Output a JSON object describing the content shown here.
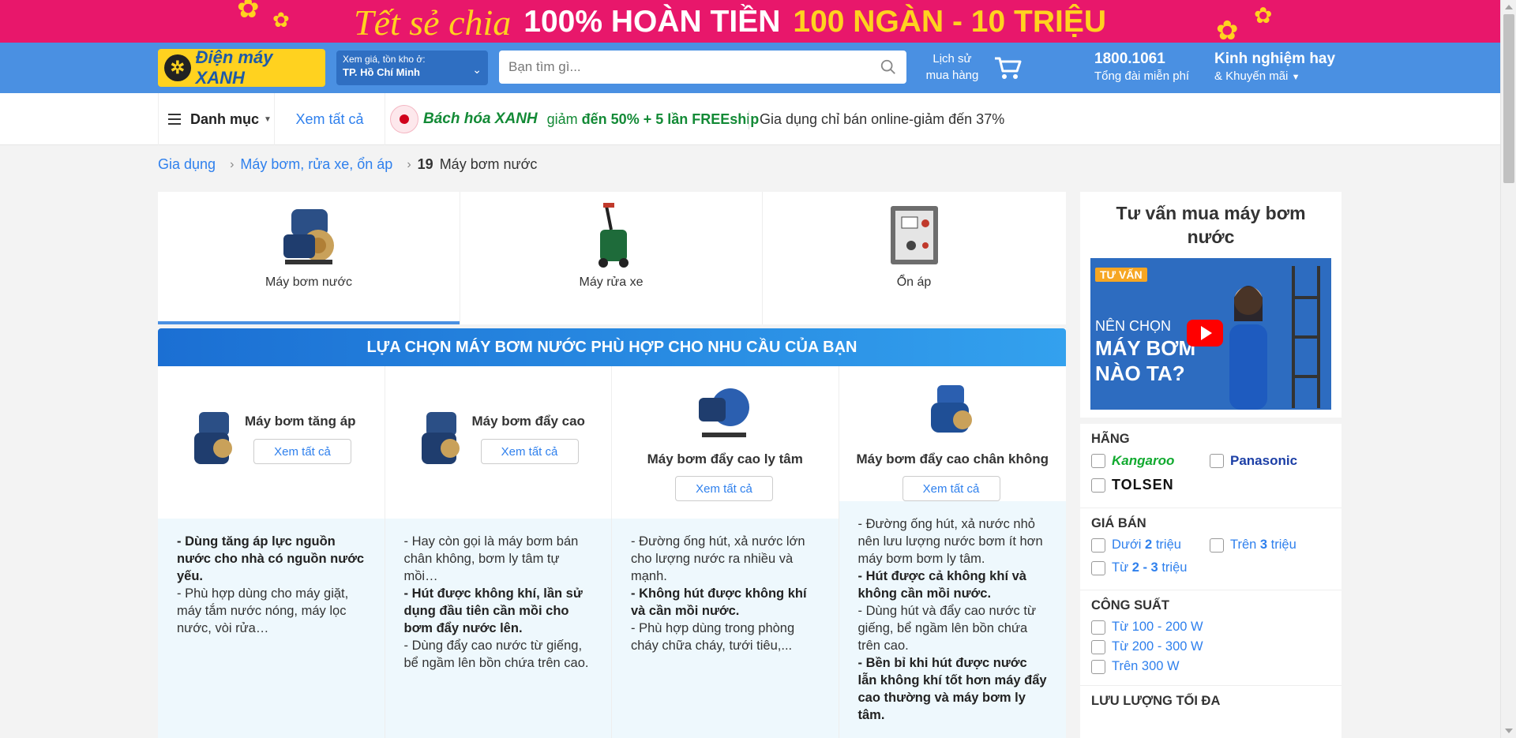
{
  "banner": {
    "script_text": "Tết sẻ chia",
    "highlight_text": "100% HOÀN TIỀN",
    "amount_text": "100 NGÀN - 10 TRIỆU"
  },
  "header": {
    "logo_text": "Điện máy XANH",
    "location_label": "Xem giá, tồn kho ở:",
    "location_value": "TP. Hồ Chí Minh",
    "search_placeholder": "Bạn tìm gì...",
    "orders_line1": "Lịch sử",
    "orders_line2": "mua hàng",
    "hotline_number": "1800.1061",
    "hotline_label": "Tổng đài miễn phí",
    "experience_title": "Kinh nghiệm hay",
    "experience_sub": "& Khuyến mãi"
  },
  "nav": {
    "menu_label": "Danh mục",
    "see_all": "Xem tất cả",
    "bhx_brand": "Bách hóa XANH",
    "bhx_promo_prefix": "giảm",
    "bhx_promo_bold": "đến 50% + 5 lần FREEship",
    "giadung_promo": "Gia dụng chỉ bán online-giảm đến 37%"
  },
  "breadcrumb": {
    "level1": "Gia dụng",
    "level2": "Máy bơm, rửa xe, ổn áp",
    "count": "19",
    "current": "Máy bơm nước"
  },
  "categories": [
    {
      "label": "Máy bơm nước",
      "active": true
    },
    {
      "label": "Máy rửa xe",
      "active": false
    },
    {
      "label": "Ổn áp",
      "active": false
    }
  ],
  "selector": {
    "title": "LỰA CHỌN MÁY BƠM NƯỚC PHÙ HỢP CHO NHU CẦU CỦA BẠN",
    "button_label": "Xem tất cả",
    "columns": [
      {
        "title": "Máy bơm tăng áp",
        "desc": [
          {
            "bold": true,
            "text": "- Dùng tăng áp lực nguồn nước cho nhà có nguồn nước yếu."
          },
          {
            "bold": false,
            "text": "- Phù hợp dùng cho máy giặt, máy tắm nước nóng, máy lọc nước, vòi rửa…"
          }
        ]
      },
      {
        "title": "Máy bơm đẩy cao",
        "desc": [
          {
            "bold": false,
            "text": "- Hay còn gọi là máy bơm bán chân không, bơm ly tâm tự mồi…"
          },
          {
            "bold": true,
            "text": "- Hút được không khí, lần sử dụng đầu tiên cần mồi cho bơm đẩy nước lên."
          },
          {
            "bold": false,
            "text": "- Dùng đẩy cao nước từ giếng, bể ngầm lên bồn chứa trên cao."
          }
        ]
      },
      {
        "title": "Máy bơm đẩy cao ly tâm",
        "desc": [
          {
            "bold": false,
            "text": "- Đường ống hút, xả nước lớn cho lượng nước ra nhiều và mạnh."
          },
          {
            "bold": true,
            "text": "- Không hút được không khí và cần mồi nước."
          },
          {
            "bold": false,
            "text": "- Phù hợp dùng trong phòng cháy chữa cháy, tưới tiêu,..."
          }
        ]
      },
      {
        "title": "Máy bơm đẩy cao chân không",
        "desc": [
          {
            "bold": false,
            "text": "- Đường ống hút, xả nước nhỏ nên lưu lượng nước bơm ít hơn máy bơm bơm ly tâm."
          },
          {
            "bold": true,
            "text": "- Hút được cả không khí và không cần mồi nước."
          },
          {
            "bold": false,
            "text": "- Dùng hút và đẩy cao nước từ giếng, bể ngầm lên bồn chứa trên cao."
          },
          {
            "bold": true,
            "text": "- Bền bỉ khi hút được nước lẫn không khí tốt hơn máy đẩy cao thường và máy bơm ly tâm."
          }
        ]
      }
    ]
  },
  "advice": {
    "title": "Tư vấn mua máy bơm nước",
    "video_tag": "TƯ VẤN",
    "video_line1": "NÊN CHỌN",
    "video_line2": "MÁY BƠM",
    "video_line3": "NÀO TA?"
  },
  "filters": {
    "brand_title": "HÃNG",
    "brands": [
      "Kangaroo",
      "Panasonic",
      "TOLSEN"
    ],
    "price_title": "GIÁ BÁN",
    "price_1_pre": "Dưới ",
    "price_1_num": "2",
    "price_1_post": " triệu",
    "price_2_pre": "Trên ",
    "price_2_num": "3",
    "price_2_post": " triệu",
    "price_3_pre": "Từ ",
    "price_3_num": "2 - 3",
    "price_3_post": " triệu",
    "power_title": "CÔNG SUẤT",
    "powers": [
      "Từ 100 - 200 W",
      "Từ 200 - 300 W",
      "Trên 300 W"
    ],
    "flow_title": "LƯU LƯỢNG TỐI ĐA"
  },
  "colors": {
    "banner_pink": "#e8176b",
    "header_blue": "#4a90e2",
    "link_blue": "#2f80ed",
    "bhx_green": "#138a36"
  }
}
